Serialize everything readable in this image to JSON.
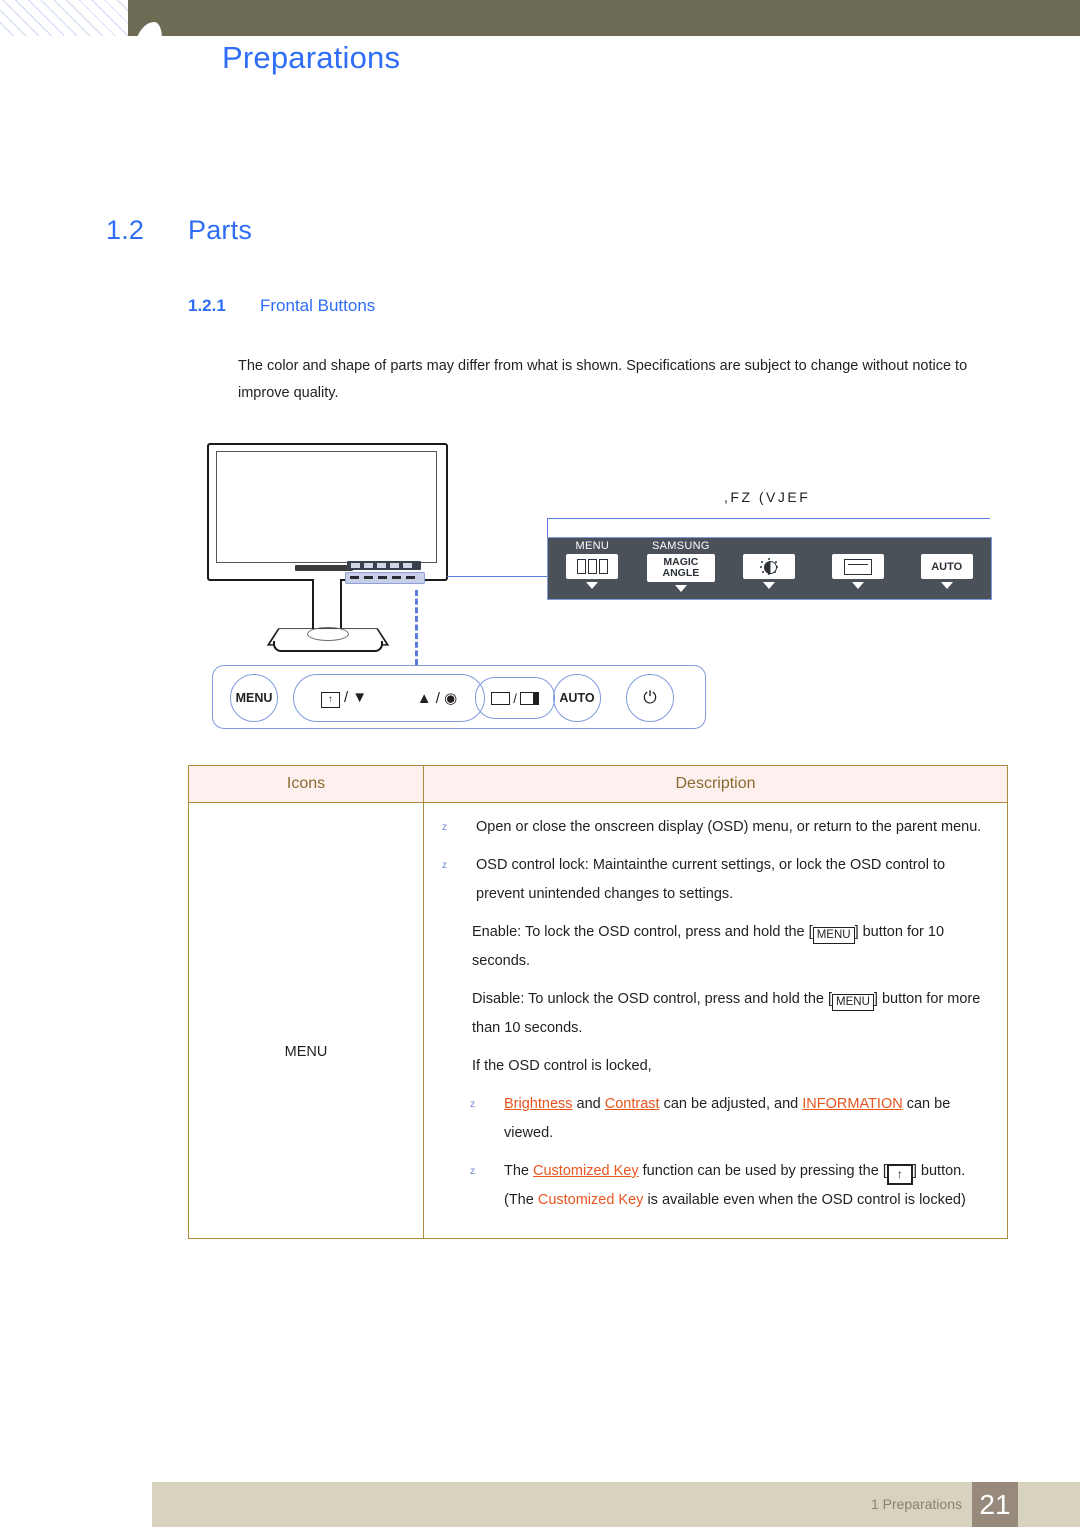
{
  "header": {
    "chapter_title": "Preparations"
  },
  "headings": {
    "h2_number": "1.2",
    "h2_title": "Parts",
    "h3_number": "1.2.1",
    "h3_title": "Frontal Buttons"
  },
  "intro": {
    "paragraph": "The color and shape of parts may differ from what is shown. Specifications are subject to change without notice to improve quality."
  },
  "key_guide": {
    "label": ",FZ (VJEF",
    "buttons": [
      {
        "caption": "MENU",
        "icon": "menu-bars-icon",
        "label": ""
      },
      {
        "caption": "SAMSUNG",
        "icon": "magic-angle-icon",
        "label_line1": "MAGIC",
        "label_line2": "ANGLE"
      },
      {
        "caption": "",
        "icon": "brightness-icon",
        "label": ""
      },
      {
        "caption": "",
        "icon": "source-loop-icon",
        "label": ""
      },
      {
        "caption": "",
        "icon": "auto-icon",
        "label": "AUTO"
      }
    ]
  },
  "front_buttons": {
    "menu_label": "MENU",
    "nav_left": "/",
    "nav_down": "▼",
    "nav_up": "▲",
    "nav_enter": "◉",
    "source_sep": "/",
    "auto_label": "AUTO",
    "power_label": "⏻"
  },
  "table": {
    "headers": [
      "Icons",
      "Description"
    ],
    "rows": [
      {
        "icon_label": "MENU",
        "description_blocks": [
          {
            "bullet": "z",
            "text": "Open or close the onscreen display (OSD) menu, or return to the parent menu."
          },
          {
            "bullet": "z",
            "text": "OSD control lock: Maintainthe current settings, or lock the OSD control to prevent unintended changes to settings."
          },
          {
            "bullet": "",
            "text_pre": "Enable: To lock the OSD control, press and hold the [",
            "key": "MENU",
            "text_post": "] button for 10 seconds."
          },
          {
            "bullet": "",
            "text_pre": "Disable: To unlock the OSD control, press and hold the [",
            "key": "MENU",
            "text_post": "] button for more than 10 seconds."
          },
          {
            "bullet": "",
            "text": "If the OSD control is locked,"
          },
          {
            "bullet": "z",
            "link1": "Brightness",
            "mid1": " and ",
            "link2": "Contrast",
            "mid2": " can be adjusted, and ",
            "link3": "INFORMATION",
            "tail": " can be viewed."
          },
          {
            "bullet": "z",
            "pre": "The ",
            "link1": "Customized Key",
            "mid1": " function can be used by pressing the [",
            "key": "↑",
            "mid2": "] button. (The ",
            "link2": "Customized Key",
            "tail": " is available even when the OSD control is locked)"
          }
        ]
      }
    ]
  },
  "footer": {
    "text": "1 Preparations",
    "page_number": "21"
  },
  "colors": {
    "accent_blue": "#2f6df6",
    "header_olive": "#6e6b55",
    "footer_band": "#d8d3bf",
    "page_box": "#97897c",
    "table_border": "#b08a3c",
    "table_header_bg": "#fdf0ef",
    "link_orange": "#e8551f",
    "bullet_blue": "#6e86d8",
    "panel_dark": "#4a5159",
    "callout_blue": "#7f9bdd"
  }
}
